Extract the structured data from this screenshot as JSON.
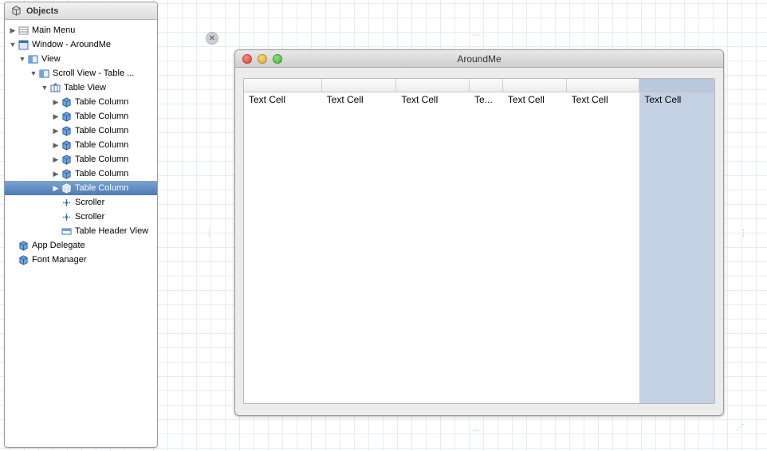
{
  "sidebar": {
    "title": "Objects",
    "items": [
      {
        "arrow": "right",
        "icon": "menu",
        "label": "Main Menu",
        "pad": 0
      },
      {
        "arrow": "down",
        "icon": "window",
        "label": "Window - AroundMe",
        "pad": 0
      },
      {
        "arrow": "down",
        "icon": "view",
        "label": "View",
        "pad": 1
      },
      {
        "arrow": "down",
        "icon": "view",
        "label": "Scroll View - Table ...",
        "pad": 2
      },
      {
        "arrow": "down",
        "icon": "table",
        "label": "Table View",
        "pad": 3
      },
      {
        "arrow": "right",
        "icon": "cube",
        "label": "Table Column",
        "pad": 4
      },
      {
        "arrow": "right",
        "icon": "cube",
        "label": "Table Column",
        "pad": 4
      },
      {
        "arrow": "right",
        "icon": "cube",
        "label": "Table Column",
        "pad": 4
      },
      {
        "arrow": "right",
        "icon": "cube",
        "label": "Table Column",
        "pad": 4
      },
      {
        "arrow": "right",
        "icon": "cube",
        "label": "Table Column",
        "pad": 4
      },
      {
        "arrow": "right",
        "icon": "cube",
        "label": "Table Column",
        "pad": 4
      },
      {
        "arrow": "right",
        "icon": "cube",
        "label": "Table Column",
        "pad": 4,
        "selected": true
      },
      {
        "arrow": "",
        "icon": "scroller",
        "label": "Scroller",
        "pad": 4
      },
      {
        "arrow": "",
        "icon": "scroller",
        "label": "Scroller",
        "pad": 4
      },
      {
        "arrow": "",
        "icon": "header",
        "label": "Table Header View",
        "pad": 4
      },
      {
        "arrow": "",
        "icon": "cube",
        "label": "App Delegate",
        "pad": 0
      },
      {
        "arrow": "",
        "icon": "cube",
        "label": "Font Manager",
        "pad": 0
      }
    ]
  },
  "window": {
    "title": "AroundMe",
    "columns": [
      {
        "width": 98,
        "cell": "Text Cell"
      },
      {
        "width": 94,
        "cell": "Text Cell"
      },
      {
        "width": 92,
        "cell": "Text Cell"
      },
      {
        "width": 42,
        "cell": "Te..."
      },
      {
        "width": 80,
        "cell": "Text Cell"
      },
      {
        "width": 92,
        "cell": "Text Cell"
      },
      {
        "width": 94,
        "cell": "Text Cell",
        "selected": true
      }
    ]
  }
}
